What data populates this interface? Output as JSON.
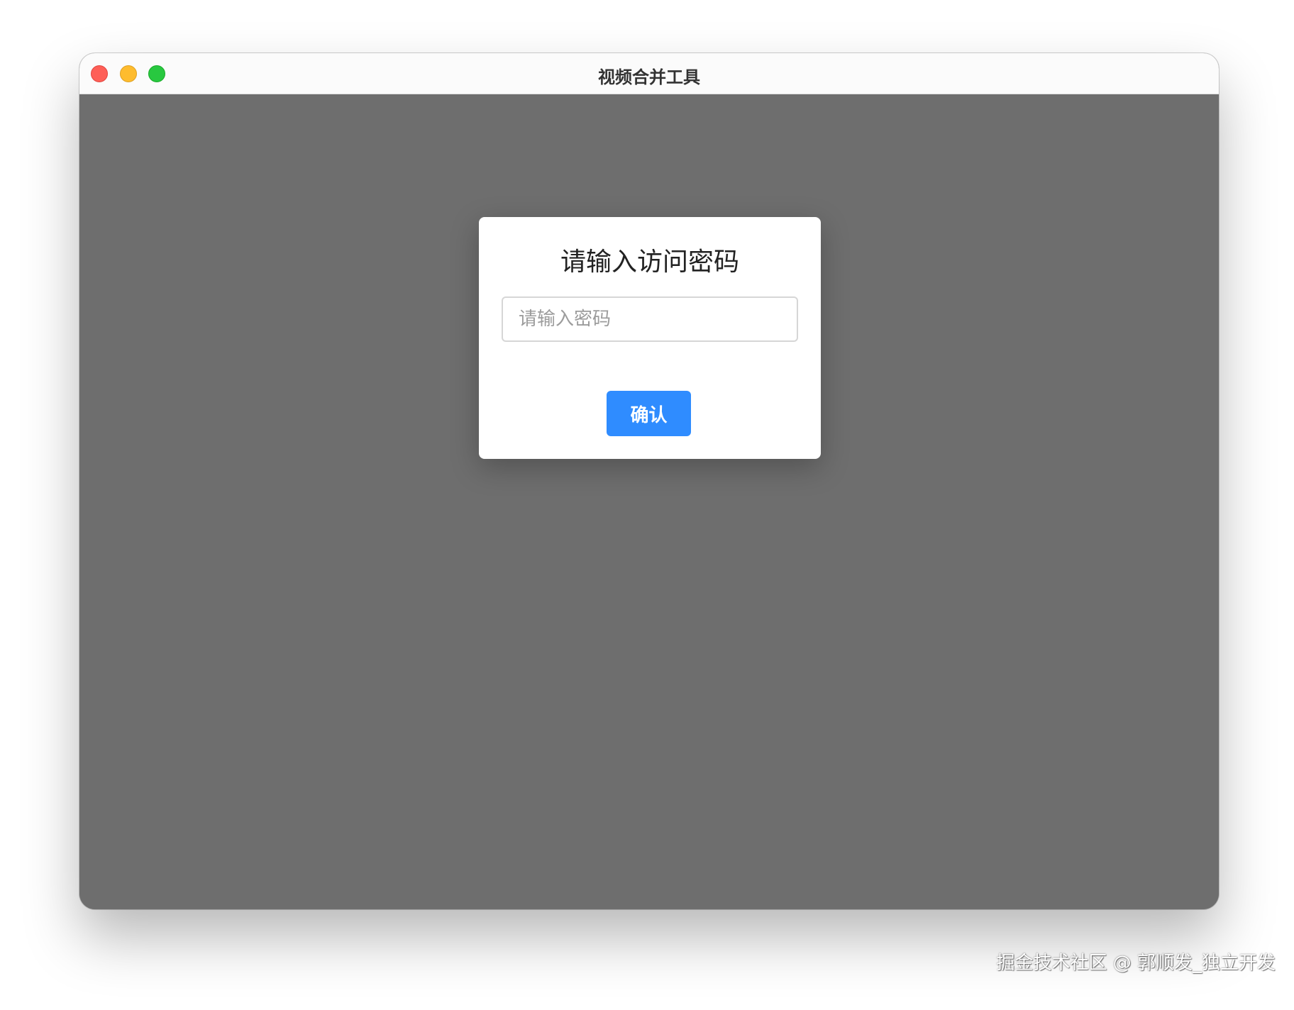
{
  "window": {
    "title": "视频合并工具",
    "controls": {
      "close": "close-button",
      "minimize": "minimize-button",
      "maximize": "maximize-button"
    }
  },
  "dialog": {
    "title": "请输入访问密码",
    "password_placeholder": "请输入密码",
    "password_value": "",
    "confirm_label": "确认"
  },
  "watermark": {
    "text": "掘金技术社区 @ 郭顺发_独立开发"
  },
  "colors": {
    "accent": "#2f8cff",
    "overlay": "#6e6e6e",
    "close": "#fe5f57",
    "minimize": "#febc2e",
    "maximize": "#28c840"
  }
}
